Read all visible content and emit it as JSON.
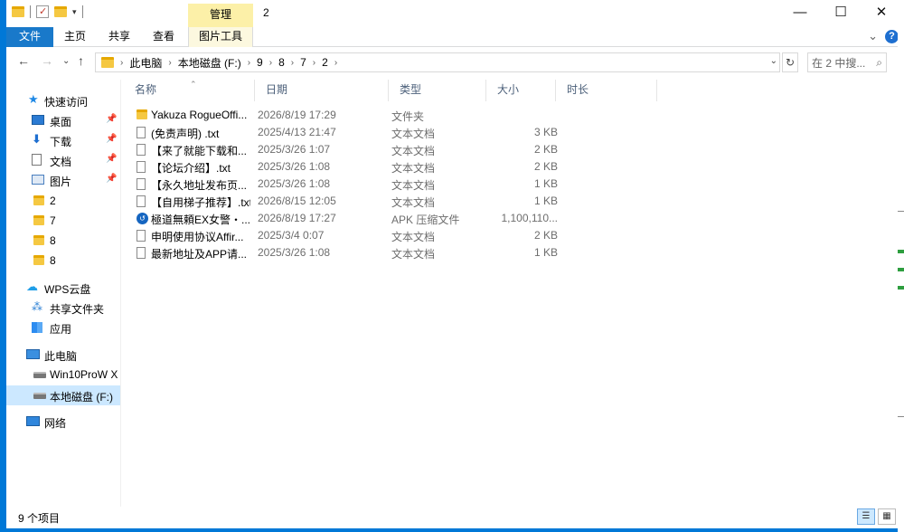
{
  "window": {
    "title": "2",
    "contextual_tab": "管理",
    "controls": {
      "minimize": "—",
      "maximize": "☐",
      "close": "✕"
    }
  },
  "ribbon": {
    "tabs": [
      "文件",
      "主页",
      "共享",
      "查看",
      "图片工具"
    ],
    "help": "?",
    "expand": "⌄"
  },
  "address": {
    "crumbs": [
      "此电脑",
      "本地磁盘 (F:)",
      "9",
      "8",
      "7",
      "2"
    ],
    "search_placeholder": "在 2 中搜...",
    "search_icon": "⌕"
  },
  "nav": {
    "quick_access": "快速访问",
    "items": [
      {
        "label": "桌面",
        "icon": "desktop-icon",
        "pinned": true
      },
      {
        "label": "下载",
        "icon": "download-icon",
        "pinned": true
      },
      {
        "label": "文档",
        "icon": "document-icon",
        "pinned": true
      },
      {
        "label": "图片",
        "icon": "pictures-icon",
        "pinned": true
      },
      {
        "label": "2",
        "icon": "folder-icon"
      },
      {
        "label": "7",
        "icon": "folder-icon"
      },
      {
        "label": "8",
        "icon": "folder-icon"
      },
      {
        "label": "8",
        "icon": "folder-icon"
      }
    ],
    "wps": "WPS云盘",
    "wps_items": [
      "共享文件夹",
      "应用"
    ],
    "this_pc": "此电脑",
    "drives": [
      "Win10ProW X",
      "本地磁盘 (F:)"
    ],
    "network": "网络"
  },
  "columns": {
    "name": "名称",
    "date": "日期",
    "type": "类型",
    "size": "大小",
    "duration": "时长"
  },
  "files": [
    {
      "name": "Yakuza RogueOffi...",
      "date": "2026/8/19 17:29",
      "type": "文件夹",
      "size": "",
      "icon": "folder"
    },
    {
      "name": "(免责声明) .txt",
      "date": "2025/4/13 21:47",
      "type": "文本文档",
      "size": "3 KB",
      "icon": "txt"
    },
    {
      "name": "【来了就能下载和...",
      "date": "2025/3/26 1:07",
      "type": "文本文档",
      "size": "2 KB",
      "icon": "txt"
    },
    {
      "name": "【论坛介绍】.txt",
      "date": "2025/3/26 1:08",
      "type": "文本文档",
      "size": "2 KB",
      "icon": "txt"
    },
    {
      "name": "【永久地址发布页...",
      "date": "2025/3/26 1:08",
      "type": "文本文档",
      "size": "1 KB",
      "icon": "txt"
    },
    {
      "name": "【自用梯子推荐】.txt",
      "date": "2026/8/15 12:05",
      "type": "文本文档",
      "size": "1 KB",
      "icon": "txt"
    },
    {
      "name": "極道無頼EX女警・...",
      "date": "2026/8/19 17:27",
      "type": "APK 压缩文件",
      "size": "1,100,110...",
      "icon": "apk"
    },
    {
      "name": "申明使用协议Affir...",
      "date": "2025/3/4 0:07",
      "type": "文本文档",
      "size": "2 KB",
      "icon": "txt"
    },
    {
      "name": "最新地址及APP请...",
      "date": "2025/3/26 1:08",
      "type": "文本文档",
      "size": "1 KB",
      "icon": "txt"
    }
  ],
  "status": {
    "count": "9 个项目"
  }
}
